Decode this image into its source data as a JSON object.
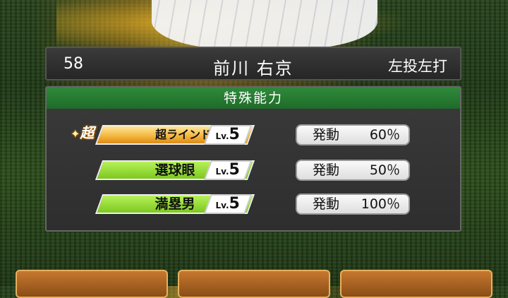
{
  "header": {
    "uniform_number": "58",
    "player_name": "前川 右京",
    "handedness": "左投左打"
  },
  "special_abilities": {
    "title": "特殊能力",
    "items": [
      {
        "badge": "超",
        "name": "超ラインドライブ",
        "level_prefix": "Lv.",
        "level": "5",
        "activation_label": "発動",
        "activation_rate": "60％",
        "style": "gold"
      },
      {
        "badge": "",
        "name": "選球眼",
        "level_prefix": "Lv.",
        "level": "5",
        "activation_label": "発動",
        "activation_rate": "50％",
        "style": "green"
      },
      {
        "badge": "",
        "name": "満塁男",
        "level_prefix": "Lv.",
        "level": "5",
        "activation_label": "発動",
        "activation_rate": "100％",
        "style": "green"
      }
    ]
  },
  "colors": {
    "panel_header": "#1f6b2a",
    "ability_green": "#7dc81f",
    "ability_gold": "#f3b33a",
    "bottom_button": "#b06420"
  }
}
